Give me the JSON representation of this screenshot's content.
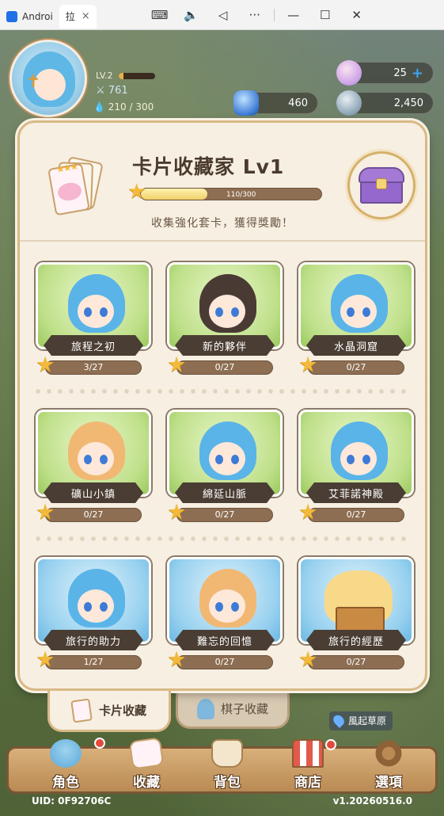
{
  "titlebar": {
    "tabs": [
      {
        "label": "Androi",
        "icon": "android-studio-icon"
      },
      {
        "label": "拉",
        "icon": "game-icon",
        "close": "×"
      }
    ],
    "controls": {
      "keyboard": "⌨",
      "volume": "🔈",
      "back": "◁",
      "more": "···",
      "minimize": "—",
      "maximize": "☐",
      "close": "✕"
    }
  },
  "hud": {
    "level_label": "LV.2",
    "level_progress": 0.12,
    "power": "761",
    "stamina": "210 / 300",
    "currencies": {
      "pink_gem": "25",
      "blue_gem": "460",
      "coin": "2,450"
    },
    "plus_symbol": "+"
  },
  "panel": {
    "title": "卡片收藏家 Lv1",
    "progress_text": "110/300",
    "progress_fraction": 0.3667,
    "subtitle": "收集強化套卡，獲得獎勵！",
    "star": "★"
  },
  "cards": [
    {
      "label": "旅程之初",
      "progress": "3/27",
      "bg": "green",
      "hair": "blue"
    },
    {
      "label": "新的夥伴",
      "progress": "0/27",
      "bg": "green",
      "hair": "dark"
    },
    {
      "label": "水晶洞窟",
      "progress": "0/27",
      "bg": "green",
      "hair": "blue"
    },
    {
      "label": "礦山小鎮",
      "progress": "0/27",
      "bg": "green",
      "hair": "orange"
    },
    {
      "label": "綿延山脈",
      "progress": "0/27",
      "bg": "green",
      "hair": "blue"
    },
    {
      "label": "艾菲諾神殿",
      "progress": "0/27",
      "bg": "green",
      "hair": "blue"
    },
    {
      "label": "旅行的助力",
      "progress": "1/27",
      "bg": "blue",
      "hair": "blue"
    },
    {
      "label": "難忘的回憶",
      "progress": "0/27",
      "bg": "blue",
      "hair": "orange"
    },
    {
      "label": "旅行的經歷",
      "progress": "0/27",
      "bg": "blue",
      "hair": "cat"
    }
  ],
  "tabs": {
    "card_collection": "卡片收藏",
    "chess_collection": "棋子收藏"
  },
  "location": "風起草原",
  "nav": [
    {
      "label": "角色",
      "icon": "character-icon",
      "badge": true
    },
    {
      "label": "收藏",
      "icon": "collection-icon",
      "badge": false
    },
    {
      "label": "背包",
      "icon": "backpack-icon",
      "badge": false
    },
    {
      "label": "商店",
      "icon": "shop-icon",
      "badge": true
    },
    {
      "label": "選項",
      "icon": "gear-icon",
      "badge": false
    }
  ],
  "footer": {
    "uid": "UID: 0F92706C",
    "version": "v1.20260516.0"
  }
}
